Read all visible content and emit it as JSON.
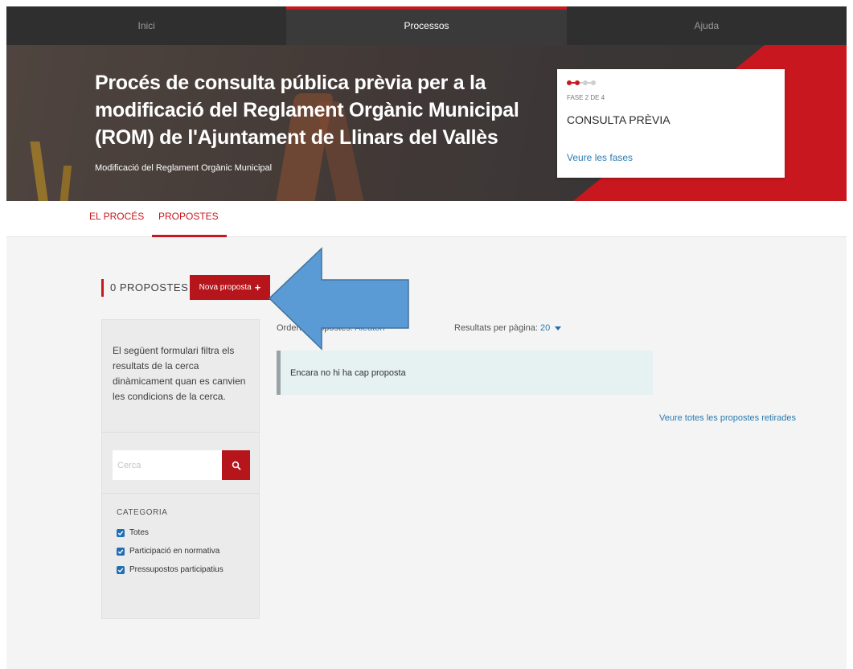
{
  "nav": {
    "items": [
      {
        "label": "Inici"
      },
      {
        "label": "Processos"
      },
      {
        "label": "Ajuda"
      }
    ],
    "active_index": 1
  },
  "hero": {
    "title": "Procés de consulta pública prèvia per a la modificació del Reglament Orgànic Municipal (ROM) de l'Ajuntament de Llinars del Vallès",
    "subtitle": "Modificació del Reglament Orgànic Municipal"
  },
  "phase": {
    "step": "FASE 2 DE 4",
    "name": "CONSULTA PRÈVIA",
    "link": "Veure les fases",
    "current": 2,
    "total": 4
  },
  "tabs": [
    {
      "label": "EL PROCÉS"
    },
    {
      "label": "PROPOSTES"
    }
  ],
  "proposals": {
    "count_label": "0 PROPOSTES",
    "new_button": "Nova proposta"
  },
  "filters": {
    "description": "El següent formulari filtra els resultats de la cerca dinàmicament quan es canvien les condicions de la cerca.",
    "search_placeholder": "Cerca",
    "category_label": "CATEGORIA",
    "categories": [
      {
        "label": "Totes",
        "checked": true
      },
      {
        "label": "Participació en normativa",
        "checked": true
      },
      {
        "label": "Pressupostos participatius",
        "checked": true
      }
    ]
  },
  "listing": {
    "order_label": "Ordenar propostes:",
    "order_value": "Aleatori",
    "per_page_label": "Resultats per pàgina:",
    "per_page_value": "20",
    "empty_message": "Encara no hi ha cap proposta",
    "withdrawn_link": "Veure totes les propostes retirades"
  },
  "colors": {
    "accent": "#c8171e",
    "link": "#2a7ab0",
    "arrow": "#5b9bd5"
  }
}
